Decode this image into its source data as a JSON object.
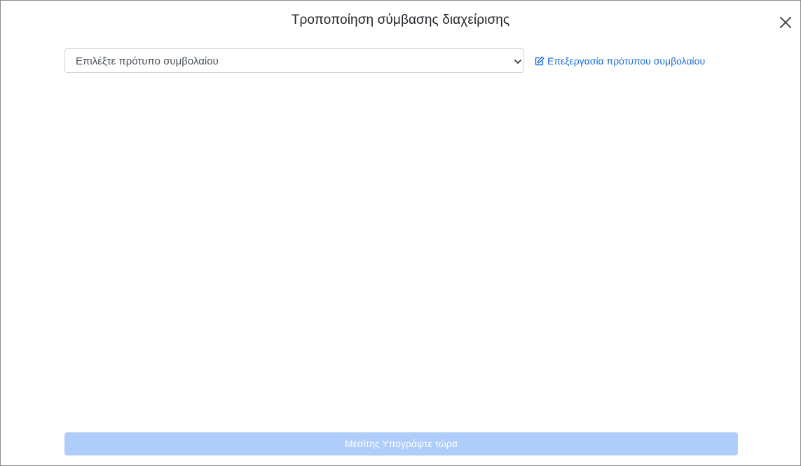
{
  "modal": {
    "title": "Τροποποίηση σύμβασης διαχείρισης",
    "close_icon": "close-icon"
  },
  "template_select": {
    "selected": "Επιλέξτε πρότυπο συμβολαίου",
    "chevron_icon": "chevron-down-icon"
  },
  "edit_template_link": {
    "label": "Επεξεργασία πρότυπου συμβολαίου",
    "icon": "edit-icon"
  },
  "sign_button": {
    "label": "Μεσίτης Υπογράψτε τώρα"
  },
  "colors": {
    "link": "#1a6bd6",
    "button_disabled_bg": "#aecdfb",
    "border": "#ced4da"
  }
}
